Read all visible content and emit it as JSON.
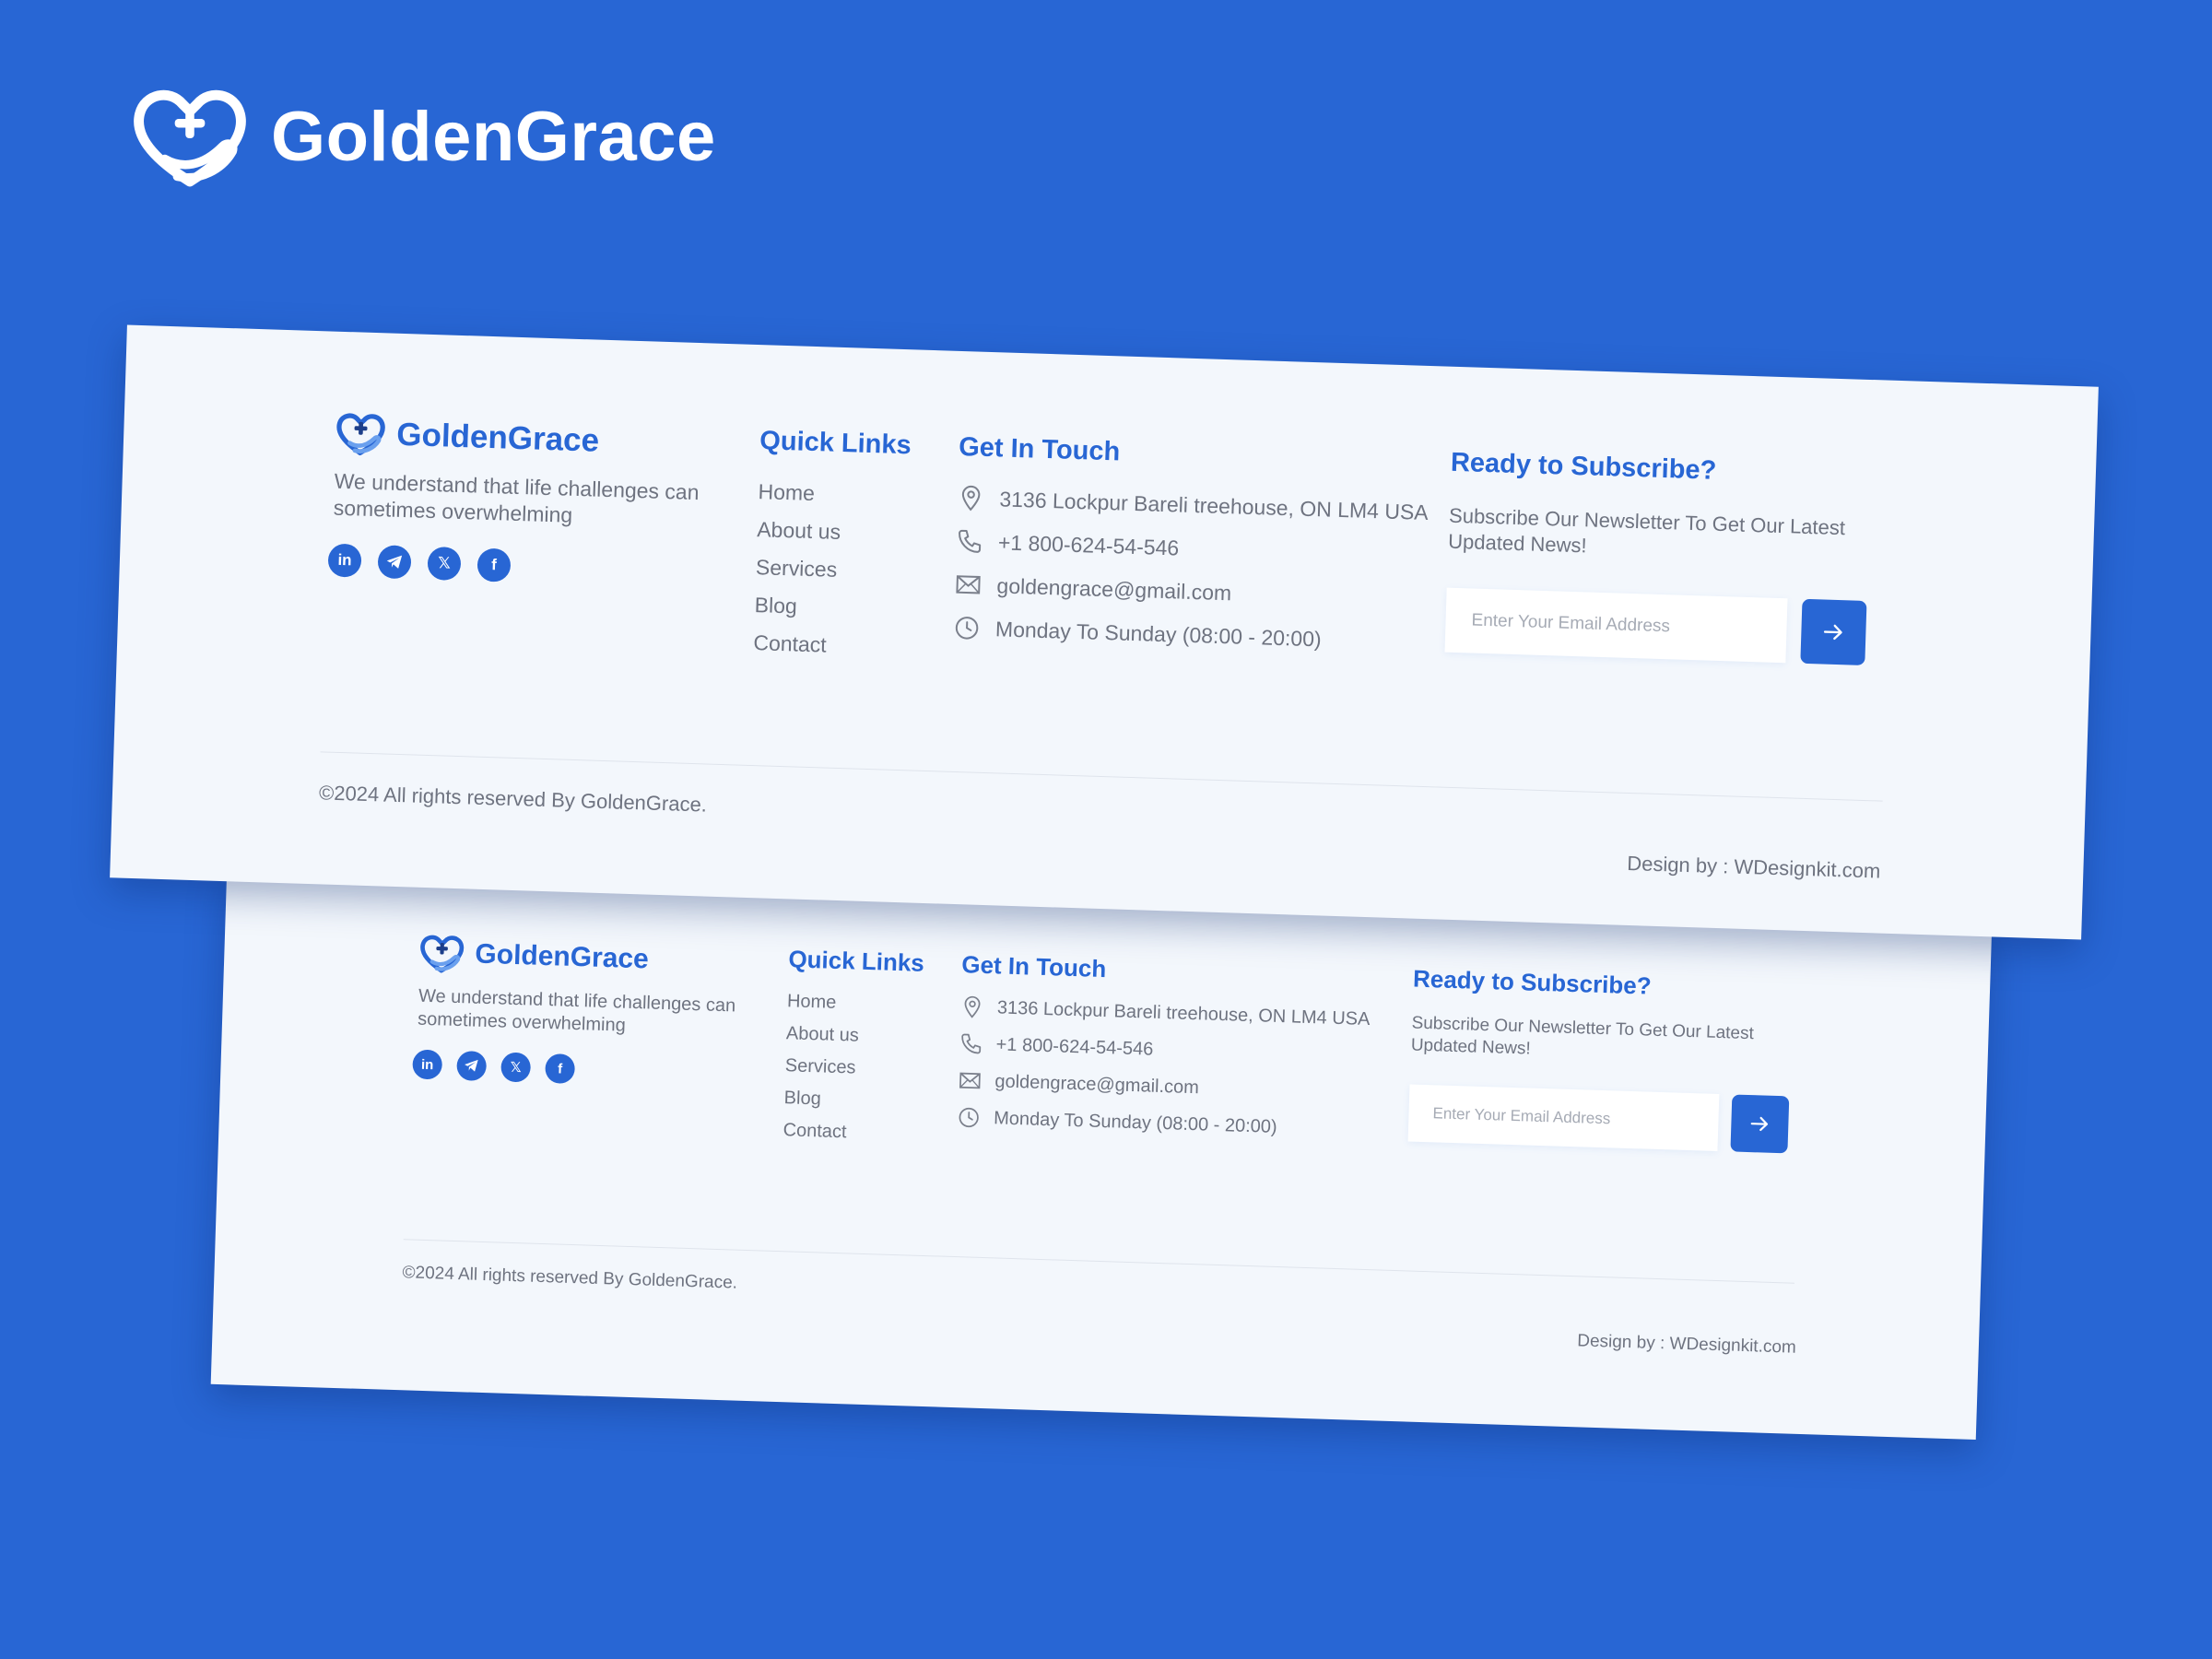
{
  "brand": {
    "name": "GoldenGrace",
    "logo_icon": "heart-hand-plus-icon",
    "accent_color": "#2866d4",
    "background_color": "#2866d4",
    "card_color": "#f3f7fc"
  },
  "footer": {
    "tagline": "We understand that life challenges can sometimes overwhelming",
    "socials": [
      {
        "icon": "linkedin-icon",
        "glyph": "in"
      },
      {
        "icon": "telegram-icon",
        "glyph": ""
      },
      {
        "icon": "x-icon",
        "glyph": "𝕏"
      },
      {
        "icon": "facebook-icon",
        "glyph": "f"
      }
    ],
    "quick_links": {
      "title": "Quick Links",
      "items": [
        "Home",
        "About us",
        "Services",
        "Blog",
        "Contact"
      ]
    },
    "get_in_touch": {
      "title": "Get In Touch",
      "address": "3136 Lockpur Bareli treehouse, ON LM4 USA",
      "phone": "+1 800-624-54-546",
      "email": "goldengrace@gmail.com",
      "hours": "Monday To Sunday (08:00 - 20:00)"
    },
    "subscribe": {
      "title": "Ready to Subscribe?",
      "text": "Subscribe Our Newsletter To Get Our Latest Updated News!",
      "placeholder": "Enter Your Email Address",
      "button_icon": "arrow-right-icon"
    },
    "copyright": "©2024 All rights reserved By GoldenGrace.",
    "design_by": "Design by : WDesignkit.com"
  }
}
